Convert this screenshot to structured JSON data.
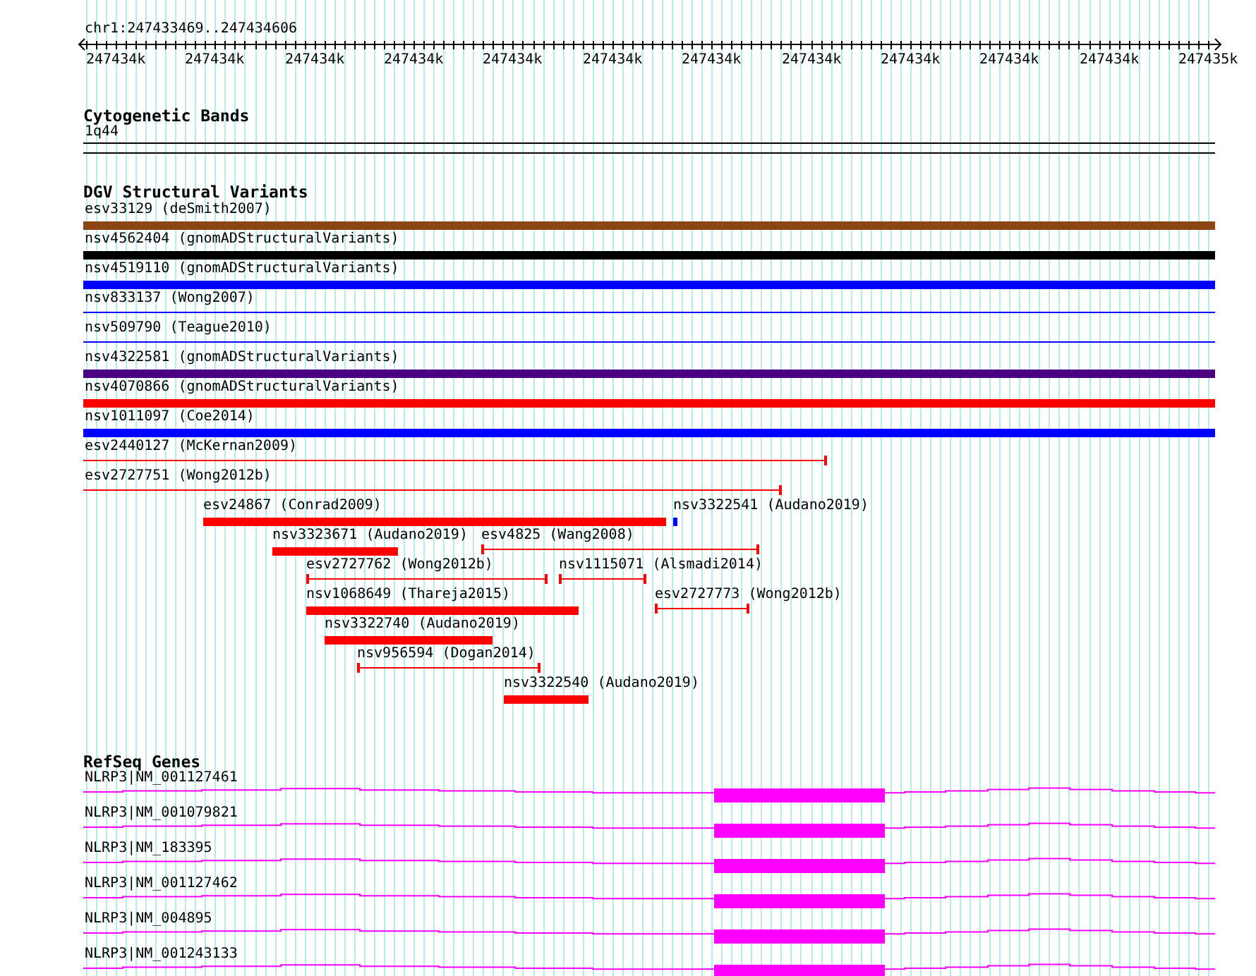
{
  "location": "chr1:247433469..247434606",
  "ruler": {
    "ticks": [
      "247434k",
      "247434k",
      "247434k",
      "247434k",
      "247434k",
      "247434k",
      "247434k",
      "247434k",
      "247434k",
      "247434k",
      "247434k",
      "247435k"
    ]
  },
  "cytogenetic_bands": {
    "title": "Cytogenetic Bands",
    "bands": [
      {
        "label": "1q44"
      }
    ]
  },
  "dgv_structural_variants": {
    "title": "DGV Structural Variants",
    "variants": [
      {
        "label": "esv33129 (deSmith2007)",
        "kind": "bar",
        "color": "#8b4513"
      },
      {
        "label": "nsv4562404 (gnomADStructuralVariants)",
        "kind": "bar",
        "color": "#000000"
      },
      {
        "label": "nsv4519110 (gnomADStructuralVariants)",
        "kind": "bar",
        "color": "#0000ff"
      },
      {
        "label": "nsv833137 (Wong2007)",
        "kind": "line",
        "color": "#0000ff"
      },
      {
        "label": "nsv509790 (Teague2010)",
        "kind": "line",
        "color": "#0000ff"
      },
      {
        "label": "nsv4322581 (gnomADStructuralVariants)",
        "kind": "bar",
        "color": "#4b0082"
      },
      {
        "label": "nsv4070866 (gnomADStructuralVariants)",
        "kind": "bar",
        "color": "#ff0000"
      },
      {
        "label": "nsv1011097 (Coe2014)",
        "kind": "bar",
        "color": "#0000ff"
      },
      {
        "label": "esv2440127 (McKernan2009)",
        "kind": "span",
        "color": "#ff0000"
      },
      {
        "label": "esv2727751 (Wong2012b)",
        "kind": "span",
        "color": "#ff0000"
      },
      {
        "label": "esv24867 (Conrad2009)",
        "kind": "bar",
        "color": "#ff0000"
      },
      {
        "label": "nsv3322541 (Audano2019)",
        "kind": "bar",
        "color": "#0000ff"
      },
      {
        "label": "nsv3323671 (Audano2019)",
        "kind": "bar",
        "color": "#ff0000"
      },
      {
        "label": "esv4825 (Wang2008)",
        "kind": "span",
        "color": "#ff0000"
      },
      {
        "label": "esv2727762 (Wong2012b)",
        "kind": "span",
        "color": "#ff0000"
      },
      {
        "label": "nsv1115071 (Alsmadi2014)",
        "kind": "span",
        "color": "#ff0000"
      },
      {
        "label": "nsv1068649 (Thareja2015)",
        "kind": "bar",
        "color": "#ff0000"
      },
      {
        "label": "esv2727773 (Wong2012b)",
        "kind": "span",
        "color": "#ff0000"
      },
      {
        "label": "nsv3322740 (Audano2019)",
        "kind": "bar",
        "color": "#ff0000"
      },
      {
        "label": "nsv956594 (Dogan2014)",
        "kind": "span",
        "color": "#ff0000"
      },
      {
        "label": "nsv3322540 (Audano2019)",
        "kind": "bar",
        "color": "#ff0000"
      }
    ]
  },
  "refseq_genes": {
    "title": "RefSeq Genes",
    "genes": [
      {
        "label": "NLRP3|NM_001127461"
      },
      {
        "label": "NLRP3|NM_001079821"
      },
      {
        "label": "NLRP3|NM_183395"
      },
      {
        "label": "NLRP3|NM_001127462"
      },
      {
        "label": "NLRP3|NM_004895"
      },
      {
        "label": "NLRP3|NM_001243133"
      }
    ]
  }
}
